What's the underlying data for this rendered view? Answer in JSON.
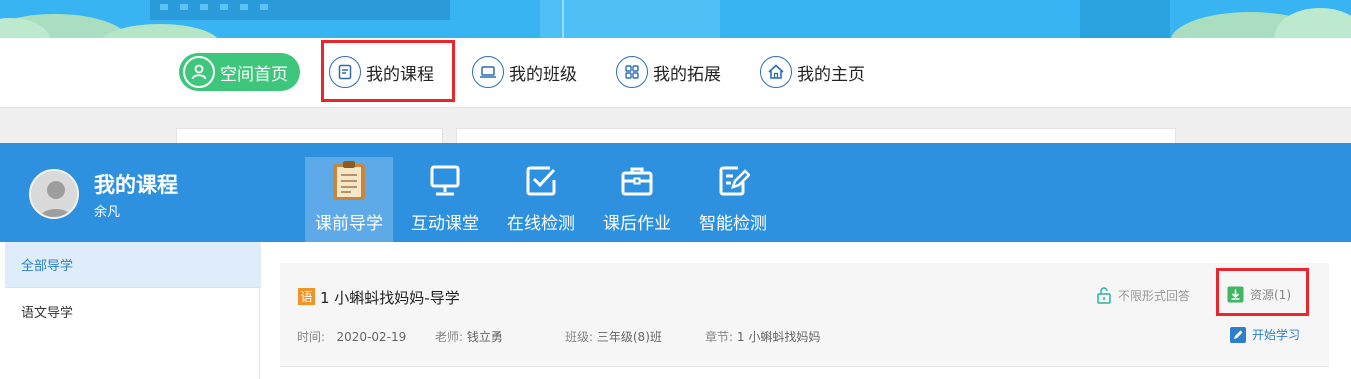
{
  "topnav": {
    "items": [
      {
        "label": "空间首页",
        "icon": "user-icon"
      },
      {
        "label": "我的课程",
        "icon": "document-icon"
      },
      {
        "label": "我的班级",
        "icon": "laptop-icon"
      },
      {
        "label": "我的拓展",
        "icon": "grid-icon"
      },
      {
        "label": "我的主页",
        "icon": "home-icon"
      }
    ]
  },
  "header": {
    "title": "我的课程",
    "user": "余凡"
  },
  "tabs": [
    {
      "label": "课前导学",
      "icon": "clipboard-icon",
      "active": true
    },
    {
      "label": "互动课堂",
      "icon": "monitor-icon"
    },
    {
      "label": "在线检测",
      "icon": "checkbox-icon"
    },
    {
      "label": "课后作业",
      "icon": "briefcase-icon"
    },
    {
      "label": "智能检测",
      "icon": "edit-icon"
    }
  ],
  "sidebar": {
    "items": [
      {
        "label": "全部导学",
        "active": true
      },
      {
        "label": "语文导学"
      }
    ]
  },
  "lesson": {
    "subject_badge": "语",
    "title": "1 小蝌蚪找妈妈-导学",
    "time_label": "时间:",
    "time_value": "2020-02-19",
    "teacher_label": "老师:",
    "teacher_value": "钱立勇",
    "class_label": "班级:",
    "class_value": "三年级(8)班",
    "chapter_label": "章节:",
    "chapter_value": "1 小蝌蚪找妈妈",
    "answer_mode": "不限形式回答",
    "resources_label": "资源(1)",
    "start_label": "开始学习"
  },
  "colors": {
    "banner": "#38b4f2",
    "header_blue": "#2d91df",
    "home_green": "#3ec77c",
    "highlight_red": "#e8262b",
    "badge_orange": "#f29327",
    "link_blue": "#2d7fcb"
  }
}
